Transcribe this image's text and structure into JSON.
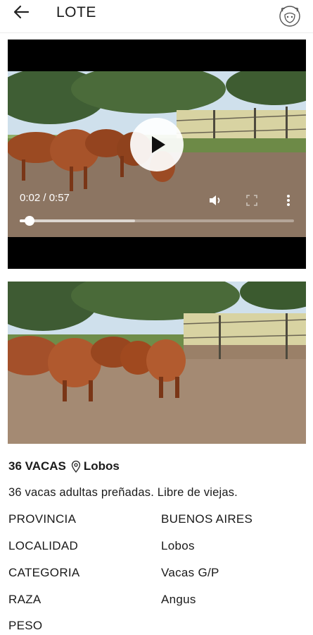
{
  "header": {
    "title": "LOTE",
    "back_icon": "arrow-left-icon",
    "logo_icon": "cow-logo-icon"
  },
  "video": {
    "time_label": "0:02 / 0:57",
    "progress_fraction": 0.035,
    "buffered_fraction": 0.42,
    "controls": [
      "play-icon",
      "volume-icon",
      "fullscreen-icon",
      "more-vert-icon"
    ]
  },
  "lot": {
    "title": "36 VACAS",
    "location": "Lobos",
    "description": "36 vacas adultas preñadas. Libre de viejas.",
    "details": [
      {
        "label": "PROVINCIA",
        "value": "BUENOS AIRES"
      },
      {
        "label": "LOCALIDAD",
        "value": "Lobos"
      },
      {
        "label": "CATEGORIA",
        "value": "Vacas G/P"
      },
      {
        "label": "RAZA",
        "value": "Angus"
      },
      {
        "label": "PESO",
        "value": ""
      }
    ]
  }
}
